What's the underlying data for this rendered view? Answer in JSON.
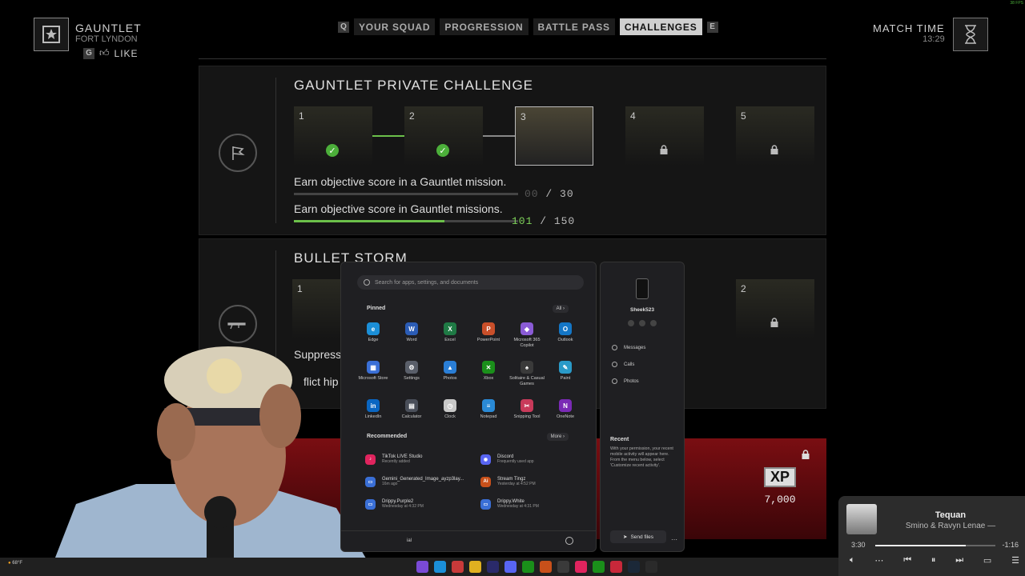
{
  "hud": {
    "mode_name": "GAUNTLET",
    "mode_sub": "FORT LYNDON",
    "like_key": "G",
    "like_label": "LIKE",
    "tabs": [
      {
        "key": "Q"
      },
      {
        "label": "YOUR SQUAD"
      },
      {
        "label": "PROGRESSION"
      },
      {
        "label": "BATTLE PASS"
      },
      {
        "label": "CHALLENGES",
        "active": true
      },
      {
        "key": "E"
      }
    ],
    "match_time_label": "MATCH TIME",
    "match_time_value": "13:29",
    "fps": "38 FPS"
  },
  "challenges": {
    "panel1": {
      "title": "GAUNTLET PRIVATE CHALLENGE",
      "rewards": [
        {
          "num": "1",
          "state": "done"
        },
        {
          "num": "2",
          "state": "done"
        },
        {
          "num": "3",
          "state": "current"
        },
        {
          "num": "4",
          "state": "locked"
        },
        {
          "num": "5",
          "state": "locked"
        }
      ],
      "task1": "Earn objective score in a Gauntlet mission.",
      "task1_done": "00",
      "task1_total": "/ 30",
      "task1_progress": 0,
      "task2": "Earn objective score in Gauntlet missions.",
      "task2_done": "101",
      "task2_total": "/ 150",
      "task2_progress": 0.67
    },
    "panel2": {
      "title": "BULLET STORM",
      "reward_left_num": "1",
      "reward_right_num": "2",
      "task1_partial": "Suppress",
      "task2_partial": "flict hip"
    },
    "xp_label": "XP",
    "xp_value": "7,000"
  },
  "start_menu": {
    "search_placeholder": "Search for apps, settings, and documents",
    "pinned_label": "Pinned",
    "all_label": "All",
    "pinned": [
      {
        "label": "Edge",
        "color": "#1b8fd8",
        "glyph": "e"
      },
      {
        "label": "Word",
        "color": "#2b5cb5",
        "glyph": "W"
      },
      {
        "label": "Excel",
        "color": "#1f7a45",
        "glyph": "X"
      },
      {
        "label": "PowerPoint",
        "color": "#c94f2a",
        "glyph": "P"
      },
      {
        "label": "Microsoft 365 Copilot",
        "color": "#8a5bd6",
        "glyph": "◆"
      },
      {
        "label": "Outlook",
        "color": "#1476c6",
        "glyph": "O"
      },
      {
        "label": "Microsoft Store",
        "color": "#3a6fd6",
        "glyph": "▦"
      },
      {
        "label": "Settings",
        "color": "#5a5f6a",
        "glyph": "⚙"
      },
      {
        "label": "Photos",
        "color": "#2a7ed6",
        "glyph": "▲"
      },
      {
        "label": "Xbox",
        "color": "#1a8f1a",
        "glyph": "✕"
      },
      {
        "label": "Solitaire & Casual Games",
        "color": "#3a3a3a",
        "glyph": "♠"
      },
      {
        "label": "Paint",
        "color": "#2a9ac8",
        "glyph": "✎"
      },
      {
        "label": "LinkedIn",
        "color": "#0a66c2",
        "glyph": "in"
      },
      {
        "label": "Calculator",
        "color": "#4a4f5a",
        "glyph": "▤"
      },
      {
        "label": "Clock",
        "color": "#c8c8c8",
        "glyph": "◷"
      },
      {
        "label": "Notepad",
        "color": "#2a8ad6",
        "glyph": "≡"
      },
      {
        "label": "Snipping Tool",
        "color": "#c83a5a",
        "glyph": "✂"
      },
      {
        "label": "OneNote",
        "color": "#7a2ab5",
        "glyph": "N"
      }
    ],
    "recommended_label": "Recommended",
    "more_label": "More",
    "recommended": [
      {
        "name": "TikTok LIVE Studio",
        "sub": "Recently added",
        "color": "#e0245e",
        "glyph": "♪"
      },
      {
        "name": "Discord",
        "sub": "Frequently used app",
        "color": "#5865f2",
        "glyph": "◉"
      },
      {
        "name": "Gemini_Generated_Image_ayzp3lay...",
        "sub": "16m ago",
        "color": "#3a6fd6",
        "glyph": "▭"
      },
      {
        "name": "Stream Tingz",
        "sub": "Yesterday at 4:52 PM",
        "color": "#c8501a",
        "glyph": "Ai"
      },
      {
        "name": "Drippy.Purple2",
        "sub": "Wednesday at 4:32 PM",
        "color": "#3a6fd6",
        "glyph": "▭"
      },
      {
        "name": "Drippy.White",
        "sub": "Wednesday at 4:31 PM",
        "color": "#3a6fd6",
        "glyph": "▭"
      }
    ],
    "user_partial": "ial"
  },
  "phone_panel": {
    "device_name": "Sheek523",
    "links": [
      "Messages",
      "Calls",
      "Photos"
    ],
    "recent_label": "Recent",
    "recent_text": "With your permission, your recent mobile activity will appear here. From the menu below, select 'Customize recent activity'.",
    "send_files": "Send files"
  },
  "media": {
    "title": "Tequan",
    "artist": "Smino & Ravyn Lenae —",
    "time_current": "3:30",
    "time_remaining": "-1:16",
    "progress": 0.75
  },
  "taskbar": {
    "weather": "68°F"
  }
}
